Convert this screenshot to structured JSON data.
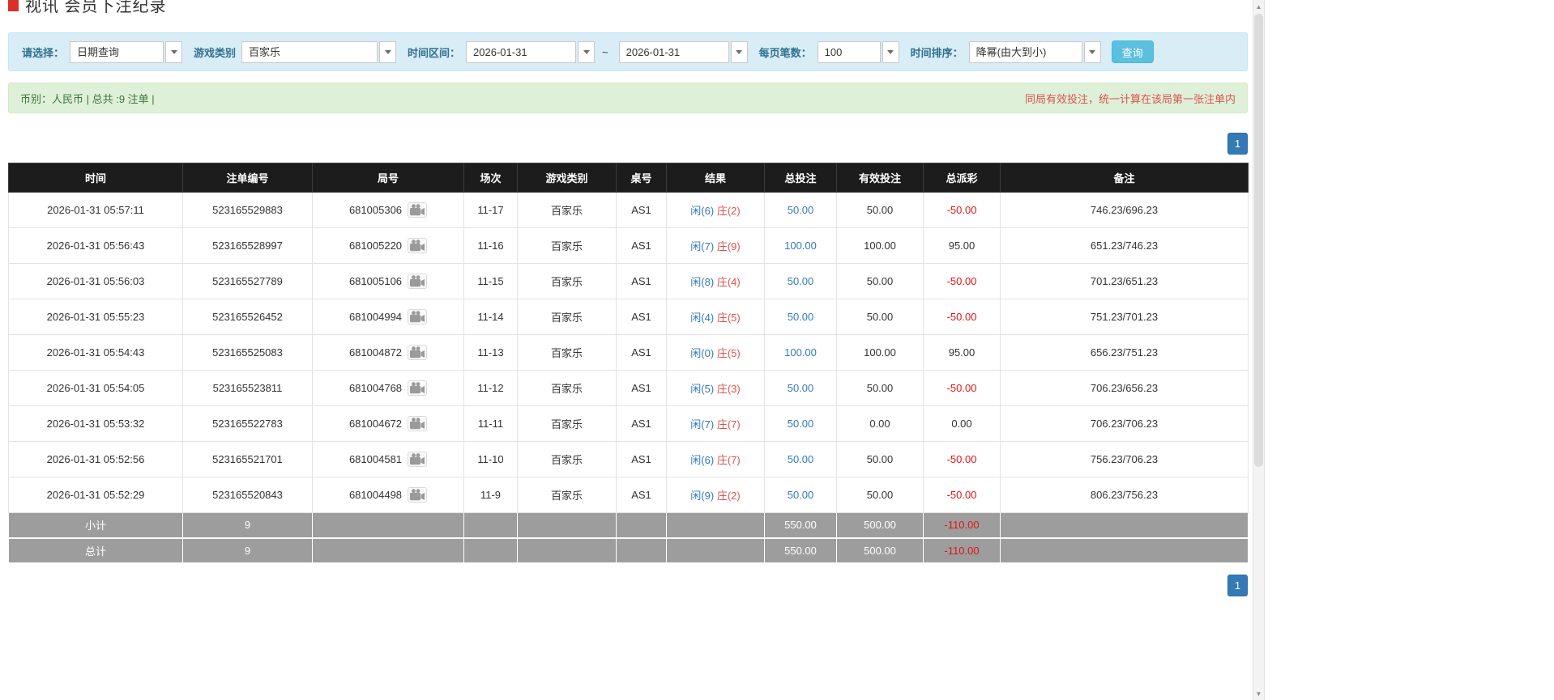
{
  "title": {
    "text": "视讯 会员下注纪录"
  },
  "filters": {
    "query_type": {
      "label": "请选择：",
      "value": "日期查询"
    },
    "game_type": {
      "label": "游戏类别",
      "value": "百家乐"
    },
    "date_range": {
      "label": "时间区间：",
      "from": "2026-01-31",
      "separator": "~",
      "to": "2026-01-31"
    },
    "page_size": {
      "label": "每页笔数：",
      "value": "100"
    },
    "sort": {
      "label": "时间排序：",
      "value": "降幂(由大到小)"
    },
    "search_button_label": "查询"
  },
  "info_bar": {
    "summary": "币别：人民币 | 总共 :9 注单 |",
    "notice": "同局有效投注，统一计算在该局第一张注单内"
  },
  "pagination": {
    "current_page": "1"
  },
  "table": {
    "headers": [
      "时间",
      "注单编号",
      "局号",
      "场次",
      "游戏类别",
      "桌号",
      "结果",
      "总投注",
      "有效投注",
      "总派彩",
      "备注"
    ],
    "rows": [
      {
        "time": "2026-01-31 05:57:11",
        "bet_number": "523165529883",
        "round_number": "681005306",
        "session": "11-17",
        "game_type": "百家乐",
        "table_number": "AS1",
        "result_player": "闲(6)",
        "result_banker": "庄(2)",
        "total_bet": "50.00",
        "valid_bet": "50.00",
        "payout": "-50.00",
        "remark": "746.23/696.23"
      },
      {
        "time": "2026-01-31 05:56:43",
        "bet_number": "523165528997",
        "round_number": "681005220",
        "session": "11-16",
        "game_type": "百家乐",
        "table_number": "AS1",
        "result_player": "闲(7)",
        "result_banker": "庄(9)",
        "total_bet": "100.00",
        "valid_bet": "100.00",
        "payout": "95.00",
        "remark": "651.23/746.23"
      },
      {
        "time": "2026-01-31 05:56:03",
        "bet_number": "523165527789",
        "round_number": "681005106",
        "session": "11-15",
        "game_type": "百家乐",
        "table_number": "AS1",
        "result_player": "闲(8)",
        "result_banker": "庄(4)",
        "total_bet": "50.00",
        "valid_bet": "50.00",
        "payout": "-50.00",
        "remark": "701.23/651.23"
      },
      {
        "time": "2026-01-31 05:55:23",
        "bet_number": "523165526452",
        "round_number": "681004994",
        "session": "11-14",
        "game_type": "百家乐",
        "table_number": "AS1",
        "result_player": "闲(4)",
        "result_banker": "庄(5)",
        "total_bet": "50.00",
        "valid_bet": "50.00",
        "payout": "-50.00",
        "remark": "751.23/701.23"
      },
      {
        "time": "2026-01-31 05:54:43",
        "bet_number": "523165525083",
        "round_number": "681004872",
        "session": "11-13",
        "game_type": "百家乐",
        "table_number": "AS1",
        "result_player": "闲(0)",
        "result_banker": "庄(5)",
        "total_bet": "100.00",
        "valid_bet": "100.00",
        "payout": "95.00",
        "remark": "656.23/751.23"
      },
      {
        "time": "2026-01-31 05:54:05",
        "bet_number": "523165523811",
        "round_number": "681004768",
        "session": "11-12",
        "game_type": "百家乐",
        "table_number": "AS1",
        "result_player": "闲(5)",
        "result_banker": "庄(3)",
        "total_bet": "50.00",
        "valid_bet": "50.00",
        "payout": "-50.00",
        "remark": "706.23/656.23"
      },
      {
        "time": "2026-01-31 05:53:32",
        "bet_number": "523165522783",
        "round_number": "681004672",
        "session": "11-11",
        "game_type": "百家乐",
        "table_number": "AS1",
        "result_player": "闲(7)",
        "result_banker": "庄(7)",
        "total_bet": "50.00",
        "valid_bet": "0.00",
        "payout": "0.00",
        "remark": "706.23/706.23"
      },
      {
        "time": "2026-01-31 05:52:56",
        "bet_number": "523165521701",
        "round_number": "681004581",
        "session": "11-10",
        "game_type": "百家乐",
        "table_number": "AS1",
        "result_player": "闲(6)",
        "result_banker": "庄(7)",
        "total_bet": "50.00",
        "valid_bet": "50.00",
        "payout": "-50.00",
        "remark": "756.23/706.23"
      },
      {
        "time": "2026-01-31 05:52:29",
        "bet_number": "523165520843",
        "round_number": "681004498",
        "session": "11-9",
        "game_type": "百家乐",
        "table_number": "AS1",
        "result_player": "闲(9)",
        "result_banker": "庄(2)",
        "total_bet": "50.00",
        "valid_bet": "50.00",
        "payout": "-50.00",
        "remark": "806.23/756.23"
      }
    ],
    "subtotal": {
      "label": "小计",
      "count": "9",
      "total_bet": "550.00",
      "valid_bet": "500.00",
      "payout": "-110.00"
    },
    "total": {
      "label": "总计",
      "count": "9",
      "total_bet": "550.00",
      "valid_bet": "500.00",
      "payout": "-110.00"
    }
  },
  "icons": {
    "dropdown": "chevron-down-icon",
    "round_video": "video-replay-icon",
    "scroll_up": "▲",
    "scroll_down": "▼"
  },
  "colors": {
    "accent-blue": "#337ab7",
    "button-info": "#5bc0de",
    "button-info-border": "#46b8da",
    "negative-red": "#e01515",
    "banker-red": "#d9534f",
    "player-blue": "#337ab7",
    "header-bg": "#1c1c1c",
    "footer-bg": "#9d9d9d",
    "filter-bg": "#d9edf7",
    "filter-border": "#bce8f1",
    "info-bg": "#dff0d8",
    "info-border": "#d6e9c6",
    "info-text": "#3c763d",
    "notice-red": "#d9534f",
    "label-blue": "#31708f",
    "title-flag-red": "#d9302c"
  }
}
